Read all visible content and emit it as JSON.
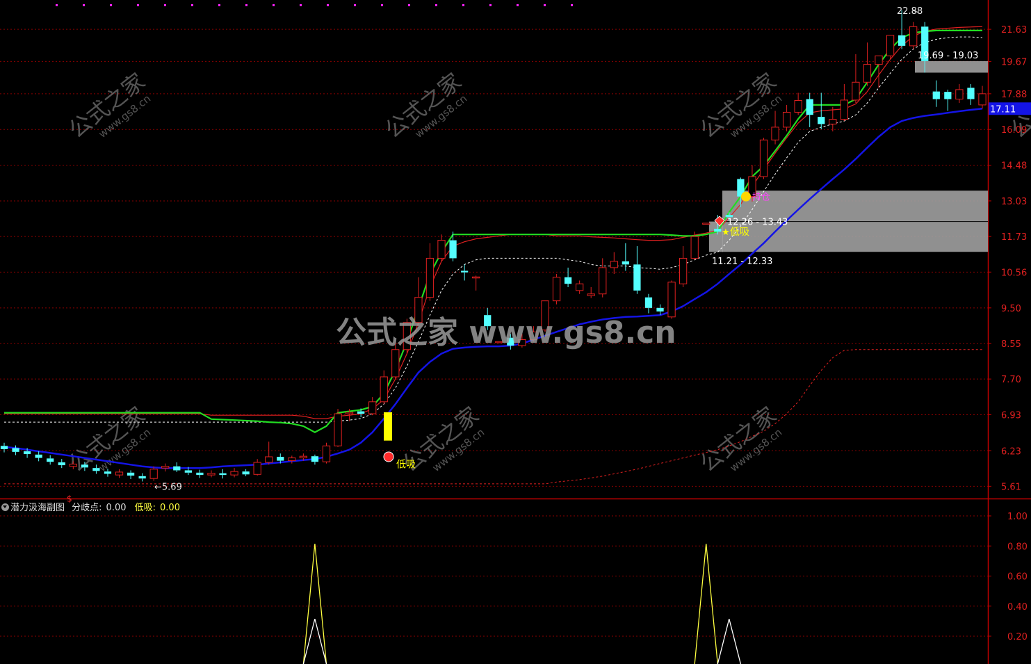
{
  "colors": {
    "background": "#000000",
    "grid": "#8b0000",
    "axis": "#c00000",
    "axis_text": "#e02020",
    "up_candle": "#e02020",
    "down_candle": "#54ffff",
    "green_line": "#22dd22",
    "blue_line": "#1414e6",
    "white_dashed": "#ffffff",
    "red_line": "#e02020",
    "zone_fill": "#a0a0a0",
    "price_tag_bg": "#1414e6",
    "sub_yellow": "#ffff40",
    "sub_white": "#ffffff",
    "watermark": "#9a9a9a"
  },
  "watermarks": {
    "center": "公式之家 www.gs8.cn",
    "tile_main": "公式之家",
    "tile_sub": "www.gs8.cn"
  },
  "main_chart": {
    "y_axis": {
      "ticks": [
        "21.63",
        "19.67",
        "17.88",
        "16.09",
        "14.48",
        "13.03",
        "11.73",
        "10.56",
        "9.50",
        "8.55",
        "7.70",
        "6.93",
        "6.23",
        "5.61"
      ]
    },
    "current_price": "17.11",
    "labels": {
      "high": "22.88",
      "low": "5.69",
      "zone_top": "19.69 - 19.03",
      "zone_mid": "12.26 - 13.43",
      "zone_low": "11.21 - 12.33",
      "signal_buy": "低吸",
      "signal_hold": "持仓"
    },
    "candles": [
      [
        6.32,
        6.26,
        6.38,
        6.2
      ],
      [
        6.28,
        6.21,
        6.33,
        6.15
      ],
      [
        6.22,
        6.17,
        6.28,
        6.1
      ],
      [
        6.16,
        6.1,
        6.22,
        6.04
      ],
      [
        6.09,
        6.03,
        6.15,
        5.98
      ],
      [
        6.02,
        5.97,
        6.08,
        5.92
      ],
      [
        5.95,
        5.99,
        6.04,
        5.9
      ],
      [
        5.98,
        5.93,
        6.03,
        5.87
      ],
      [
        5.92,
        5.87,
        5.98,
        5.82
      ],
      [
        5.86,
        5.82,
        5.91,
        5.77
      ],
      [
        5.8,
        5.85,
        5.9,
        5.75
      ],
      [
        5.84,
        5.79,
        5.88,
        5.73
      ],
      [
        5.78,
        5.74,
        5.83,
        5.69
      ],
      [
        5.74,
        5.9,
        5.95,
        5.7
      ],
      [
        5.92,
        5.95,
        6.0,
        5.86
      ],
      [
        5.95,
        5.88,
        6.02,
        5.85
      ],
      [
        5.88,
        5.84,
        5.94,
        5.8
      ],
      [
        5.84,
        5.8,
        5.89,
        5.75
      ],
      [
        5.8,
        5.83,
        5.88,
        5.76
      ],
      [
        5.83,
        5.8,
        5.9,
        5.74
      ],
      [
        5.8,
        5.86,
        5.92,
        5.76
      ],
      [
        5.86,
        5.81,
        5.9,
        5.78
      ],
      [
        5.81,
        6.02,
        6.08,
        5.79
      ],
      [
        6.02,
        6.12,
        6.4,
        5.98
      ],
      [
        6.12,
        6.05,
        6.18,
        6.0
      ],
      [
        6.05,
        6.1,
        6.14,
        6.0
      ],
      [
        6.1,
        6.13,
        6.18,
        6.05
      ],
      [
        6.13,
        6.03,
        6.16,
        5.98
      ],
      [
        6.03,
        6.32,
        6.38,
        6.0
      ],
      [
        6.32,
        6.95,
        7.05,
        6.3
      ],
      [
        6.95,
        6.98,
        7.05,
        6.8
      ],
      [
        7.0,
        6.95,
        7.06,
        6.88
      ],
      [
        6.95,
        7.2,
        7.3,
        6.92
      ],
      [
        7.2,
        7.75,
        7.9,
        7.15
      ],
      [
        7.75,
        8.4,
        8.6,
        7.7
      ],
      [
        8.4,
        9.1,
        9.2,
        8.3
      ],
      [
        9.1,
        9.8,
        10.4,
        9.0
      ],
      [
        9.8,
        11.0,
        11.5,
        9.7
      ],
      [
        11.0,
        11.6,
        11.8,
        10.9
      ],
      [
        11.6,
        11.0,
        11.9,
        10.9
      ],
      [
        10.6,
        10.55,
        10.8,
        10.3
      ],
      [
        10.4,
        10.41,
        10.45,
        10.0
      ],
      [
        9.3,
        9.0,
        9.5,
        8.9
      ],
      [
        8.6,
        8.6,
        8.6,
        8.56
      ],
      [
        8.7,
        8.5,
        8.8,
        8.4
      ],
      [
        8.5,
        8.65,
        8.8,
        8.45
      ],
      [
        8.65,
        8.85,
        9.0,
        8.6
      ],
      [
        8.9,
        9.7,
        9.7,
        8.85
      ],
      [
        9.7,
        10.4,
        10.5,
        9.6
      ],
      [
        10.4,
        10.2,
        10.7,
        10.1
      ],
      [
        10.0,
        10.2,
        10.3,
        9.9
      ],
      [
        9.85,
        9.9,
        10.1,
        9.78
      ],
      [
        9.9,
        10.7,
        11.0,
        9.8
      ],
      [
        10.7,
        10.9,
        11.2,
        10.5
      ],
      [
        10.9,
        10.8,
        11.5,
        10.6
      ],
      [
        10.8,
        10.0,
        11.4,
        9.9
      ],
      [
        9.8,
        9.5,
        9.9,
        9.35
      ],
      [
        9.5,
        9.4,
        9.6,
        9.3
      ],
      [
        9.25,
        10.25,
        10.3,
        9.2
      ],
      [
        10.2,
        11.0,
        11.4,
        10.1
      ],
      [
        11.0,
        11.73,
        11.9,
        10.95
      ],
      [
        12.2,
        12.2,
        12.2,
        12.2
      ],
      [
        12.0,
        11.9,
        12.5,
        11.8
      ],
      [
        12.5,
        12.42,
        12.6,
        12.3
      ],
      [
        13.9,
        13.2,
        13.96,
        12.8
      ],
      [
        13.2,
        14.0,
        14.48,
        13.0
      ],
      [
        14.0,
        15.6,
        15.7,
        13.9
      ],
      [
        15.6,
        16.2,
        17.0,
        15.4
      ],
      [
        16.2,
        16.93,
        17.3,
        16.0
      ],
      [
        16.93,
        17.53,
        17.93,
        16.8
      ],
      [
        17.6,
        16.8,
        17.93,
        16.2
      ],
      [
        16.7,
        16.35,
        17.93,
        16.1
      ],
      [
        16.35,
        16.58,
        17.2,
        16.0
      ],
      [
        16.58,
        17.55,
        18.4,
        16.5
      ],
      [
        17.55,
        18.5,
        20.1,
        17.4
      ],
      [
        18.5,
        19.5,
        20.8,
        18.3
      ],
      [
        19.5,
        20.0,
        20.0,
        18.2
      ],
      [
        20.0,
        21.25,
        21.25,
        19.8
      ],
      [
        21.25,
        20.6,
        22.88,
        20.4
      ],
      [
        20.6,
        21.8,
        22.1,
        20.4
      ],
      [
        21.8,
        19.69,
        22.1,
        19.03
      ],
      [
        18.0,
        17.6,
        18.6,
        17.2
      ],
      [
        17.98,
        17.6,
        18.1,
        17.0
      ],
      [
        17.6,
        18.1,
        18.4,
        17.4
      ],
      [
        18.2,
        17.6,
        18.4,
        17.3
      ],
      [
        17.3,
        17.88,
        18.3,
        17.11
      ]
    ],
    "green_line": [
      6.97,
      6.97,
      6.97,
      6.97,
      6.97,
      6.97,
      6.97,
      6.97,
      6.97,
      6.97,
      6.97,
      6.97,
      6.97,
      6.97,
      6.97,
      6.97,
      6.97,
      6.97,
      6.84,
      6.83,
      6.82,
      6.81,
      6.8,
      6.78,
      6.77,
      6.75,
      6.7,
      6.58,
      6.7,
      6.97,
      7.0,
      7.03,
      7.1,
      7.38,
      7.9,
      8.6,
      9.5,
      10.5,
      11.2,
      11.8,
      11.8,
      11.8,
      11.8,
      11.8,
      11.8,
      11.8,
      11.8,
      11.8,
      11.8,
      11.8,
      11.8,
      11.8,
      11.8,
      11.8,
      11.8,
      11.8,
      11.8,
      11.8,
      11.78,
      11.75,
      11.75,
      11.8,
      11.9,
      12.6,
      13.2,
      14.0,
      14.45,
      15.1,
      15.8,
      16.6,
      17.3,
      17.3,
      17.3,
      17.3,
      17.6,
      18.5,
      19.5,
      20.4,
      21.1,
      21.4,
      21.5,
      21.55,
      21.55,
      21.55,
      21.55,
      21.55
    ],
    "red_line": [
      6.95,
      6.95,
      6.95,
      6.95,
      6.95,
      6.95,
      6.95,
      6.95,
      6.95,
      6.95,
      6.95,
      6.95,
      6.95,
      6.95,
      6.95,
      6.95,
      6.95,
      6.95,
      6.92,
      6.92,
      6.92,
      6.92,
      6.92,
      6.92,
      6.92,
      6.92,
      6.9,
      6.85,
      6.85,
      6.9,
      6.92,
      6.95,
      7.05,
      7.25,
      7.7,
      8.3,
      9.1,
      10.1,
      10.9,
      11.4,
      11.55,
      11.65,
      11.7,
      11.75,
      11.8,
      11.8,
      11.8,
      11.8,
      11.75,
      11.75,
      11.75,
      11.72,
      11.7,
      11.68,
      11.65,
      11.62,
      11.6,
      11.6,
      11.62,
      11.7,
      11.78,
      11.85,
      11.95,
      12.4,
      12.9,
      13.6,
      14.3,
      15.0,
      15.7,
      16.4,
      16.9,
      17.0,
      17.05,
      17.1,
      17.35,
      18.0,
      18.9,
      19.8,
      20.6,
      21.2,
      21.5,
      21.65,
      21.7,
      21.75,
      21.78,
      21.8
    ],
    "white_dashed": [
      6.78,
      6.78,
      6.78,
      6.78,
      6.78,
      6.78,
      6.78,
      6.78,
      6.78,
      6.78,
      6.78,
      6.78,
      6.78,
      6.78,
      6.78,
      6.78,
      6.78,
      6.78,
      6.78,
      6.78,
      6.78,
      6.78,
      6.78,
      6.78,
      6.78,
      6.78,
      6.78,
      6.78,
      6.78,
      6.8,
      6.82,
      6.85,
      6.95,
      7.15,
      7.5,
      8.0,
      8.6,
      9.3,
      10.0,
      10.5,
      10.8,
      10.95,
      11.0,
      11.0,
      11.0,
      11.0,
      11.0,
      11.0,
      11.0,
      10.95,
      10.9,
      10.8,
      10.75,
      10.75,
      10.75,
      10.7,
      10.68,
      10.65,
      10.7,
      10.8,
      10.95,
      11.1,
      11.2,
      11.6,
      12.1,
      12.7,
      13.4,
      14.1,
      14.8,
      15.5,
      16.0,
      16.2,
      16.35,
      16.5,
      16.8,
      17.4,
      18.2,
      19.0,
      19.8,
      20.4,
      20.8,
      21.0,
      21.1,
      21.15,
      21.15,
      21.1
    ],
    "blue_line": [
      6.3,
      6.28,
      6.25,
      6.22,
      6.19,
      6.16,
      6.13,
      6.1,
      6.07,
      6.04,
      6.01,
      5.98,
      5.95,
      5.93,
      5.92,
      5.92,
      5.92,
      5.92,
      5.93,
      5.95,
      5.96,
      5.97,
      5.98,
      6.0,
      6.02,
      6.04,
      6.06,
      6.08,
      6.12,
      6.18,
      6.25,
      6.38,
      6.58,
      6.85,
      7.15,
      7.5,
      7.85,
      8.1,
      8.3,
      8.42,
      8.45,
      8.47,
      8.48,
      8.48,
      8.5,
      8.55,
      8.65,
      8.75,
      8.85,
      8.95,
      9.05,
      9.12,
      9.18,
      9.22,
      9.25,
      9.26,
      9.28,
      9.3,
      9.4,
      9.55,
      9.75,
      9.95,
      10.2,
      10.5,
      10.8,
      11.15,
      11.5,
      11.9,
      12.3,
      12.7,
      13.1,
      13.5,
      13.9,
      14.3,
      14.75,
      15.25,
      15.75,
      16.2,
      16.5,
      16.65,
      16.75,
      16.82,
      16.9,
      16.98,
      17.05,
      17.11
    ],
    "red_dashed": [
      5.65,
      5.65,
      5.65,
      5.65,
      5.65,
      5.65,
      5.65,
      5.65,
      5.65,
      5.65,
      5.65,
      5.65,
      5.65,
      5.65,
      5.65,
      5.65,
      5.65,
      5.65,
      5.65,
      5.65,
      5.65,
      5.65,
      5.65,
      5.65,
      5.65,
      5.65,
      5.65,
      5.65,
      5.65,
      5.65,
      5.65,
      5.65,
      5.65,
      5.65,
      5.65,
      5.65,
      5.65,
      5.65,
      5.65,
      5.65,
      5.65,
      5.65,
      5.65,
      5.65,
      5.65,
      5.65,
      5.65,
      5.65,
      5.68,
      5.7,
      5.72,
      5.75,
      5.78,
      5.82,
      5.86,
      5.9,
      5.95,
      6.0,
      6.05,
      6.1,
      6.15,
      6.2,
      6.25,
      6.32,
      6.4,
      6.5,
      6.6,
      6.75,
      6.95,
      7.2,
      7.55,
      7.9,
      8.2,
      8.38,
      8.4,
      8.4,
      8.4,
      8.4,
      8.4,
      8.4,
      8.4,
      8.4,
      8.4,
      8.4,
      8.4,
      8.4
    ]
  },
  "sub_chart": {
    "title": "潜力汲海副图",
    "field1_label": "分歧点:",
    "field1_value": "0.00",
    "field2_label": "低吸:",
    "field2_value": "0.00",
    "y_ticks": [
      "1.00",
      "0.80",
      "0.60",
      "0.40",
      "0.20"
    ],
    "yellow_series": [
      {
        "x": 27,
        "values": [
          0,
          1,
          0
        ]
      },
      {
        "x": 61,
        "values": [
          0,
          1,
          0
        ]
      }
    ],
    "white_series": [
      {
        "x": 27,
        "values": [
          0,
          0.5,
          0
        ]
      },
      {
        "x": 63,
        "values": [
          0,
          0.5,
          0
        ]
      }
    ]
  },
  "chart_data": {
    "type": "candlestick",
    "ylim": [
      5.5,
      23.2
    ],
    "scale": "log",
    "high_label": "22.88",
    "low_label": "5.69",
    "last_price": "17.11",
    "y_ticks": [
      21.63,
      19.67,
      17.88,
      16.09,
      14.48,
      13.03,
      11.73,
      10.56,
      9.5,
      8.55,
      7.7,
      6.93,
      6.23,
      5.61
    ],
    "sub_y_ticks": [
      1.0,
      0.8,
      0.6,
      0.4,
      0.2
    ]
  }
}
